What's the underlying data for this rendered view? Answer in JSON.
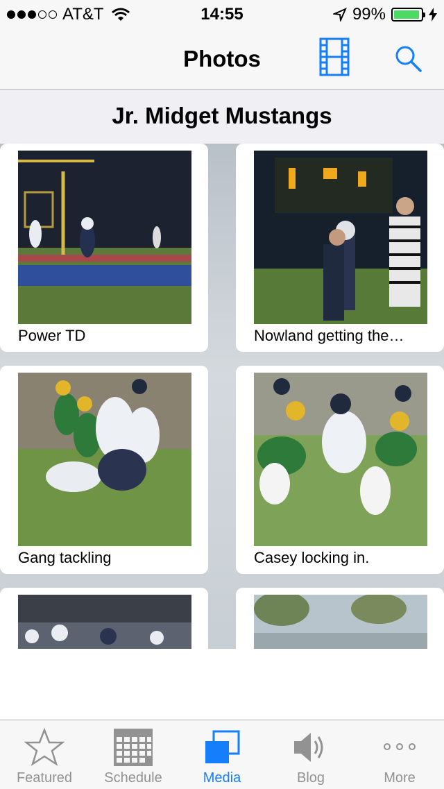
{
  "status": {
    "carrier": "AT&T",
    "time": "14:55",
    "battery": "99%",
    "battery_level": 0.99
  },
  "nav": {
    "title": "Photos",
    "video_icon": "film-strip-icon",
    "search_icon": "search-icon"
  },
  "section": {
    "title": "Jr. Midget Mustangs"
  },
  "photos": [
    {
      "caption": "Power TD"
    },
    {
      "caption": "Nowland getting the…"
    },
    {
      "caption": "Gang tackling"
    },
    {
      "caption": "Casey locking in."
    },
    {
      "caption": ""
    },
    {
      "caption": ""
    }
  ],
  "tabs": [
    {
      "label": "Featured",
      "icon": "star-icon"
    },
    {
      "label": "Schedule",
      "icon": "calendar-icon"
    },
    {
      "label": "Media",
      "icon": "media-icon"
    },
    {
      "label": "Blog",
      "icon": "speaker-icon"
    },
    {
      "label": "More",
      "icon": "more-icon"
    }
  ],
  "colors": {
    "accent": "#157efb",
    "tab_inactive": "#929292",
    "battery": "#4cd964"
  }
}
